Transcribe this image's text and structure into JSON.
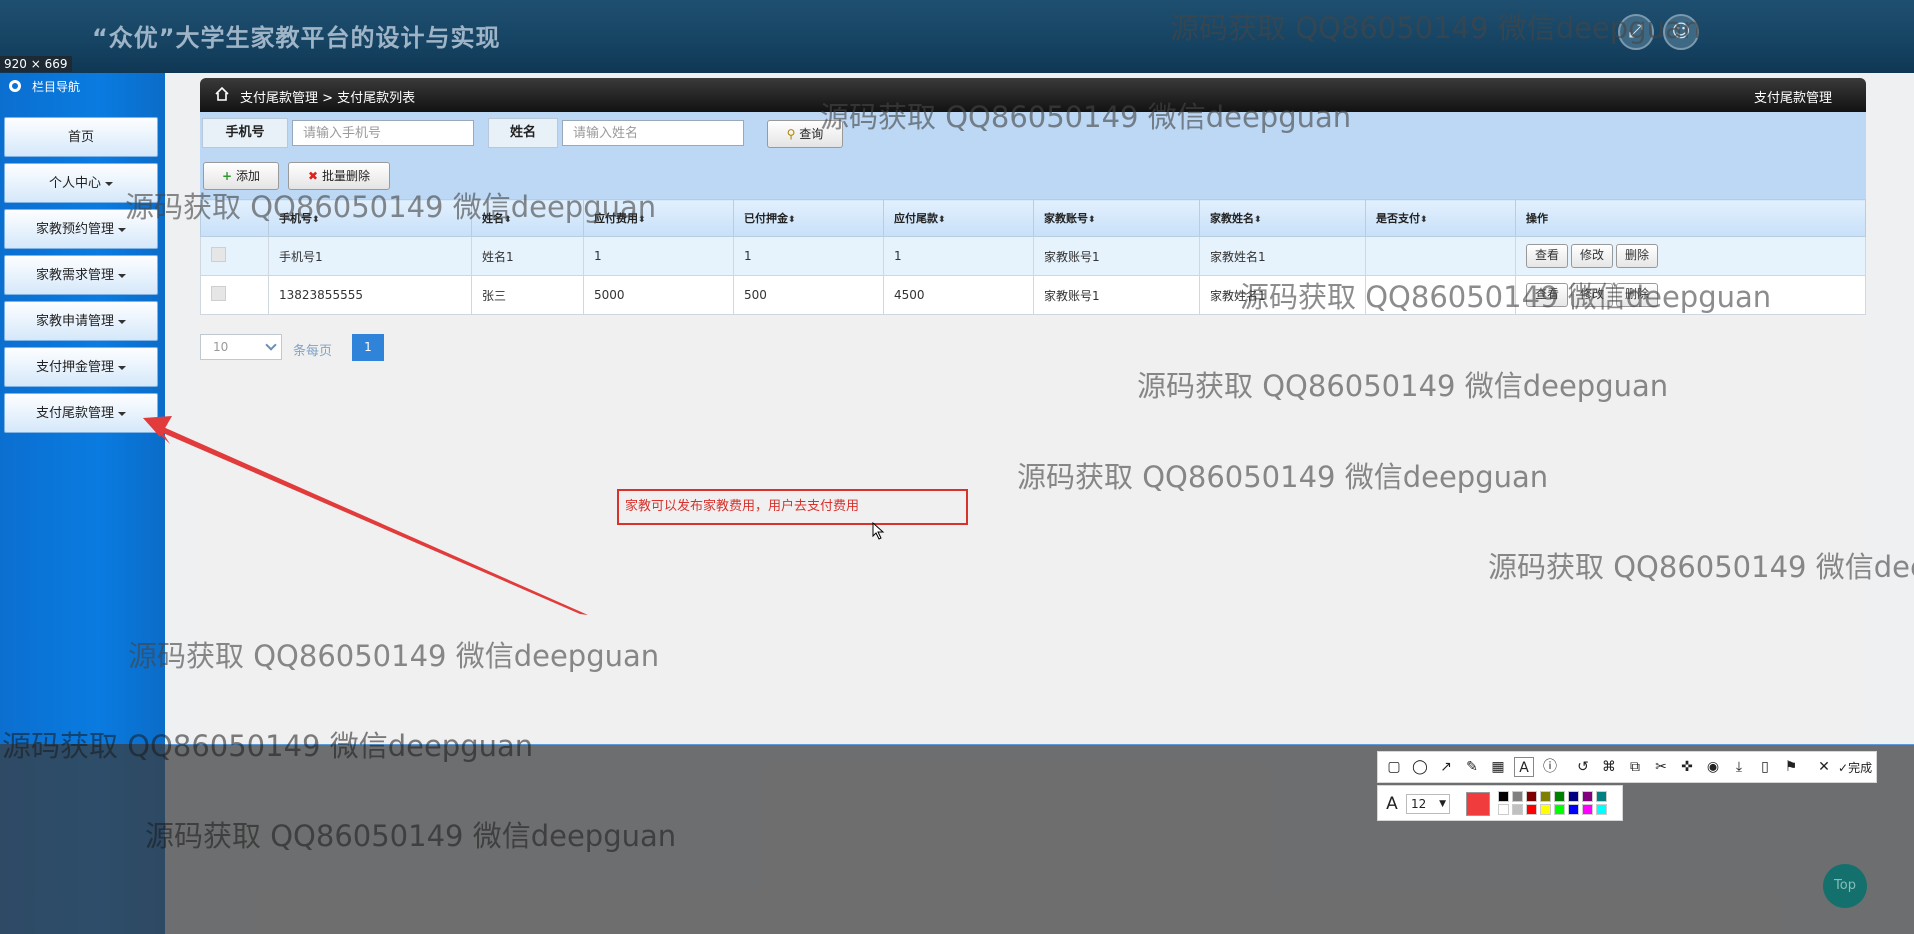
{
  "header": {
    "title": "“众优”大学生家教平台的设计与实现",
    "capture_size": "920 × 669"
  },
  "sidebar": {
    "header": "栏目导航",
    "items": [
      {
        "label": "首页",
        "has_caret": false
      },
      {
        "label": "个人中心",
        "has_caret": true
      },
      {
        "label": "家教预约管理",
        "has_caret": true
      },
      {
        "label": "家教需求管理",
        "has_caret": true
      },
      {
        "label": "家教申请管理",
        "has_caret": true
      },
      {
        "label": "支付押金管理",
        "has_caret": true
      },
      {
        "label": "支付尾款管理",
        "has_caret": true
      }
    ]
  },
  "breadcrumb": {
    "path": "支付尾款管理 > 支付尾款列表",
    "right": "支付尾款管理"
  },
  "search": {
    "phone_label": "手机号",
    "phone_placeholder": "请输入手机号",
    "name_label": "姓名",
    "name_placeholder": "请输入姓名",
    "query_label": "查询",
    "add_label": "添加",
    "batch_delete_label": "批量删除"
  },
  "table": {
    "columns": [
      "手机号",
      "姓名",
      "应付费用",
      "已付押金",
      "应付尾款",
      "家教账号",
      "家教姓名",
      "是否支付",
      "操作"
    ],
    "rows": [
      [
        "手机号1",
        "姓名1",
        "1",
        "1",
        "1",
        "家教账号1",
        "家教姓名1",
        ""
      ],
      [
        "13823855555",
        "张三",
        "5000",
        "500",
        "4500",
        "家教账号1",
        "家教姓名1",
        ""
      ]
    ],
    "actions": [
      "查看",
      "修改",
      "删除"
    ]
  },
  "pagination": {
    "page_size": "10",
    "per_page_label": "条每页",
    "current_page": "1"
  },
  "annotation": {
    "text": "家教可以发布家教费用，用户去支付费用"
  },
  "toolbar": {
    "font_size": "12",
    "done_label": "完成",
    "selected_color": "#f03c3c",
    "palette": [
      "#000000",
      "#808080",
      "#800000",
      "#808000",
      "#008000",
      "#000080",
      "#800080",
      "#008080",
      "#ffffff",
      "#c0c0c0",
      "#ff0000",
      "#ffff00",
      "#00ff00",
      "#0000ff",
      "#ff00ff",
      "#00ffff"
    ]
  },
  "top_button": "Top",
  "watermark": "源码获取 QQ86050149 微信deepguan"
}
